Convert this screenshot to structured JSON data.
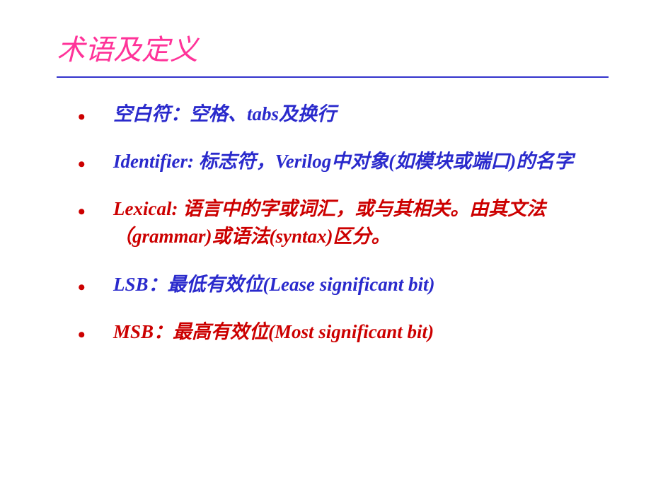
{
  "title": "术语及定义",
  "items": [
    {
      "text": "空白符：空格、tabs及换行",
      "color": "blue"
    },
    {
      "text": "Identifier: 标志符，Verilog中对象(如模块或端口)的名字",
      "color": "blue"
    },
    {
      "text": "Lexical: 语言中的字或词汇，或与其相关。由其文法（grammar)或语法(syntax)区分。",
      "color": "red"
    },
    {
      "text": "LSB：最低有效位(Lease significant bit)",
      "color": "blue"
    },
    {
      "text": "MSB：最高有效位(Most significant bit)",
      "color": "red"
    }
  ]
}
